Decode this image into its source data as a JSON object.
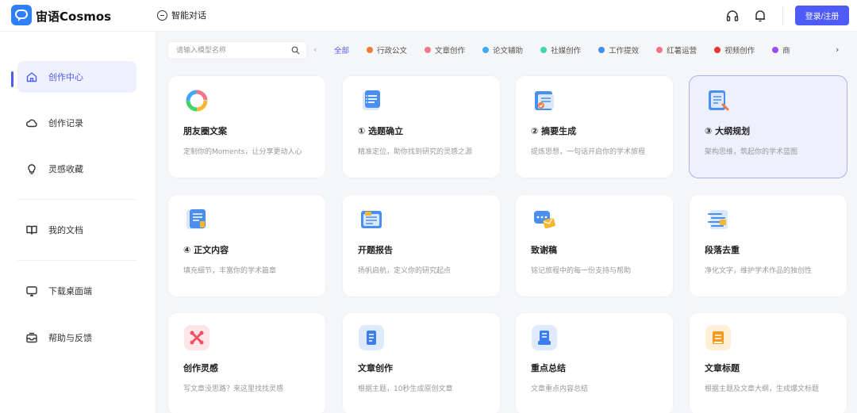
{
  "header": {
    "brand": "宙语Cosmos",
    "nav_chat": "智能对话",
    "login_label": "登录/注册"
  },
  "sidebar": {
    "items": [
      {
        "label": "创作中心",
        "icon": "home-icon",
        "active": true
      },
      {
        "label": "创作记录",
        "icon": "cloud-icon"
      },
      {
        "label": "灵感收藏",
        "icon": "lightbulb-icon"
      },
      {
        "label": "我的文档",
        "icon": "book-icon"
      },
      {
        "label": "下载桌面端",
        "icon": "monitor-icon"
      },
      {
        "label": "帮助与反馈",
        "icon": "inbox-icon"
      }
    ]
  },
  "search": {
    "placeholder": "请输入模型名称"
  },
  "tabs": [
    {
      "label": "全部",
      "color": "",
      "active": true
    },
    {
      "label": "行政公文",
      "color": "#f07b3f"
    },
    {
      "label": "文章创作",
      "color": "#f2768a"
    },
    {
      "label": "论文辅助",
      "color": "#3fa9f5"
    },
    {
      "label": "社媒创作",
      "color": "#3dd6b0"
    },
    {
      "label": "工作提效",
      "color": "#3f8ef5"
    },
    {
      "label": "红薯运营",
      "color": "#f2768a"
    },
    {
      "label": "视频创作",
      "color": "#e83535"
    },
    {
      "label": "商",
      "color": "#9b4df6"
    }
  ],
  "cards": [
    {
      "title": "朋友圈文案",
      "desc": "定制你的Moments，让分享更动人心",
      "icon": "ring-icon"
    },
    {
      "title": "① 选题确立",
      "desc": "精准定位，助你找到研究的灵感之源",
      "icon": "document-list-icon"
    },
    {
      "title": "② 摘要生成",
      "desc": "提炼思想，一句话开启你的学术旅程",
      "icon": "document-check-icon"
    },
    {
      "title": "③ 大纲规划",
      "desc": "架构思维，筑起你的学术蓝图",
      "icon": "document-pen-icon"
    },
    {
      "title": "④ 正文内容",
      "desc": "填充细节，丰富你的学术篇章",
      "icon": "document-lines-icon"
    },
    {
      "title": "开题报告",
      "desc": "扬帆启航，定义你的研究起点",
      "icon": "report-icon"
    },
    {
      "title": "致谢稿",
      "desc": "铭记旅程中的每一份支持与帮助",
      "icon": "chat-envelope-icon"
    },
    {
      "title": "段落去重",
      "desc": "净化文字，维护学术作品的独创性",
      "icon": "paragraph-icon"
    },
    {
      "title": "创作灵感",
      "desc": "写文章没思路？来这里找找灵感",
      "icon": "sparkle-icon"
    },
    {
      "title": "文章创作",
      "desc": "根据主题，10秒生成原创文章",
      "icon": "article-icon"
    },
    {
      "title": "重点总结",
      "desc": "文章重点内容总结",
      "icon": "summary-icon"
    },
    {
      "title": "文章标题",
      "desc": "根据主题及文章大纲，生成爆文标题",
      "icon": "title-icon"
    }
  ]
}
